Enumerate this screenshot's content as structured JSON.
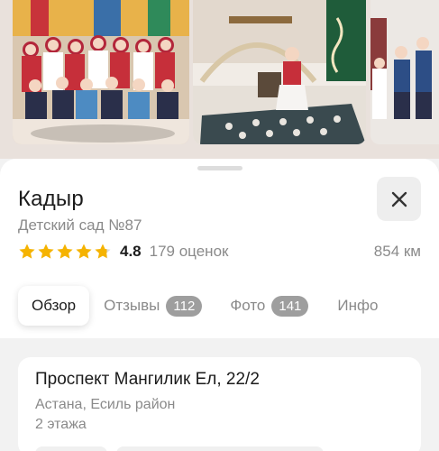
{
  "place": {
    "name": "Кадыр",
    "category": "Детский сад №87",
    "rating_value": "4.8",
    "rating_count": "179 оценок",
    "stars": 4.8,
    "distance": "854 км"
  },
  "tabs": [
    {
      "label": "Обзор",
      "badge": null,
      "active": true
    },
    {
      "label": "Отзывы",
      "badge": "112",
      "active": false
    },
    {
      "label": "Фото",
      "badge": "141",
      "active": false
    },
    {
      "label": "Инфо",
      "badge": null,
      "active": false
    }
  ],
  "address": {
    "street": "Проспект Мангилик Ел, 22/2",
    "area": "Астана, Есиль район",
    "floors": "2 этажа"
  },
  "icons": {
    "close": "close-icon",
    "star": "star-icon"
  },
  "colors": {
    "star": "#f5b301",
    "badge": "#9e9e9e",
    "text_primary": "#1b1b1b",
    "text_secondary": "#8a8a8a"
  }
}
